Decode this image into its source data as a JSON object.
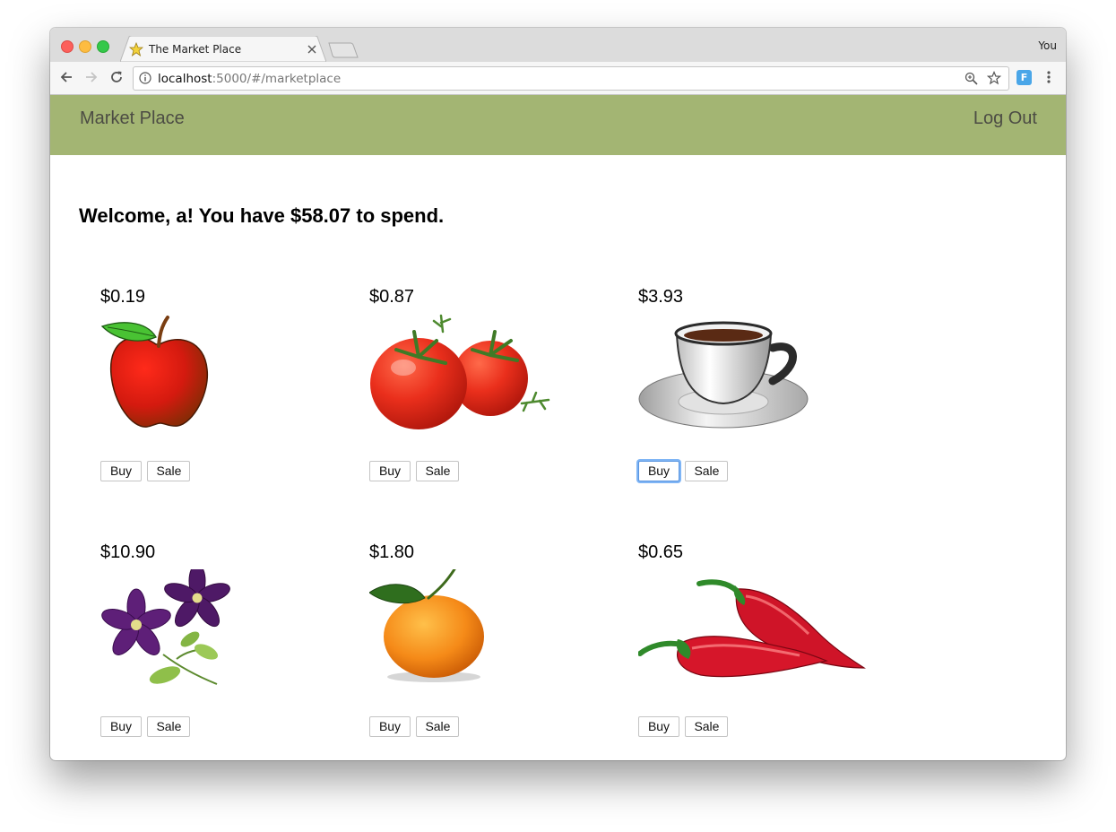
{
  "browser": {
    "tab_title": "The Market Place",
    "profile_name": "You",
    "url_host": "localhost",
    "url_rest": ":5000/#/marketplace",
    "extension_label": "F"
  },
  "navbar": {
    "brand": "Market Place",
    "logout": "Log Out",
    "background": "#a3b573"
  },
  "welcome": "Welcome, a! You have $58.07 to spend.",
  "buttons": {
    "buy": "Buy",
    "sale": "Sale"
  },
  "products": [
    {
      "price": "$0.19",
      "image": "apple"
    },
    {
      "price": "$0.87",
      "image": "tomatoes"
    },
    {
      "price": "$3.93",
      "image": "coffee-cup"
    },
    {
      "price": "$10.90",
      "image": "clematis-flowers"
    },
    {
      "price": "$1.80",
      "image": "tangerine"
    },
    {
      "price": "$0.65",
      "image": "red-chili-peppers"
    }
  ]
}
